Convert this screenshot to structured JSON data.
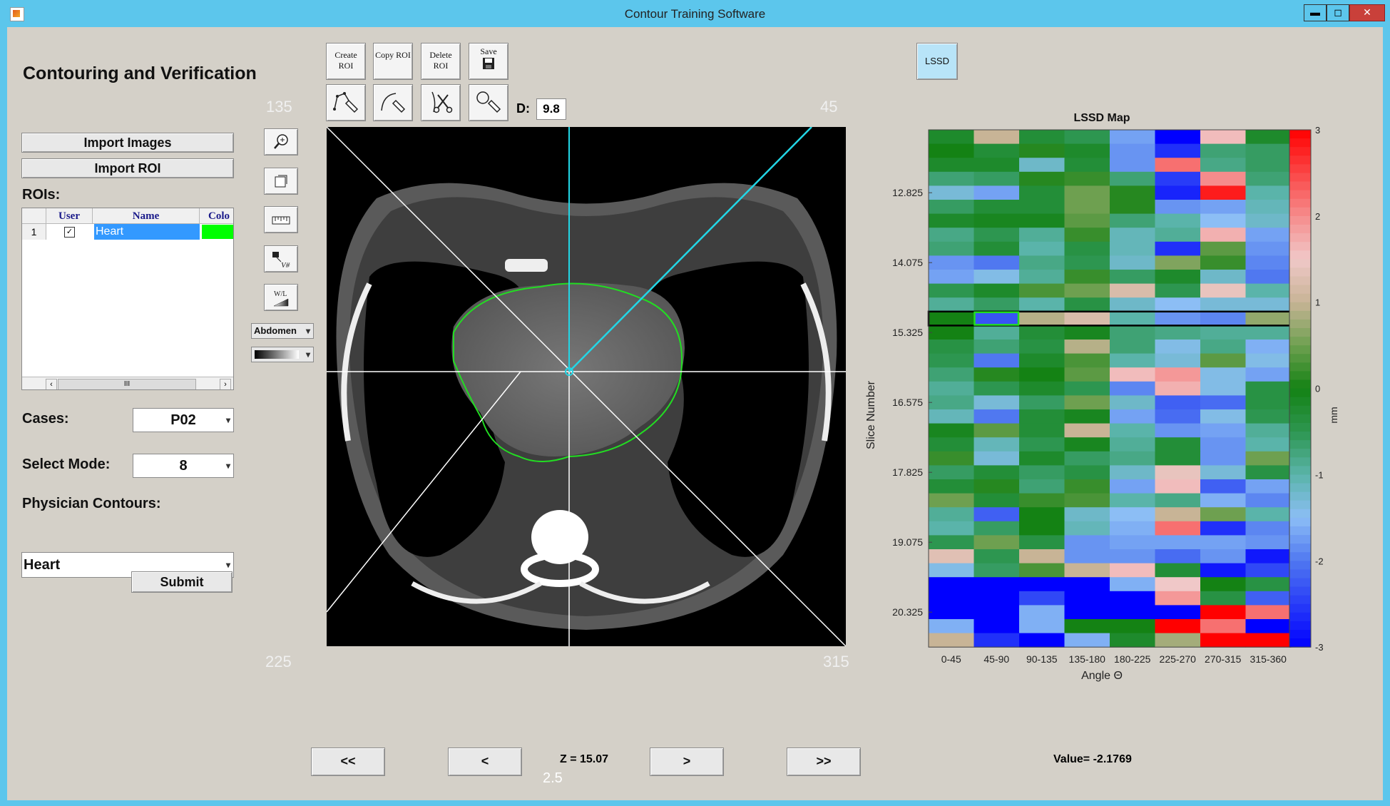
{
  "window": {
    "title": "Contour Training Software",
    "minimize": "▬",
    "maximize": "◻",
    "close": "✕"
  },
  "panel": {
    "heading": "Contouring and Verification",
    "import_images": "Import Images",
    "import_roi": "Import ROI",
    "rois_label": "ROIs:",
    "table": {
      "columns": [
        "User",
        "Name",
        "Colo"
      ],
      "rows": [
        {
          "index": "1",
          "user_checked": true,
          "name": "Heart",
          "color": "#00ff00"
        }
      ],
      "scroll_mid": "III"
    },
    "cases_label": "Cases:",
    "cases_value": "P02",
    "mode_label": "Select Mode:",
    "mode_value": "8",
    "physician_label": "Physician Contours:",
    "physician_value": "Heart",
    "submit": "Submit"
  },
  "toolbar": {
    "create_roi": "Create ROI",
    "copy_roi": "Copy ROI",
    "delete_roi": "Delete ROI",
    "save": "Save",
    "d_label": "D:",
    "d_value": "9.8",
    "window_preset": "Abdomen",
    "wl_label": "W/L",
    "vnum_label": "V#"
  },
  "viewer": {
    "angle_tl": "135",
    "angle_tr": "45",
    "angle_bl": "225",
    "angle_br": "315",
    "z_label": "Z = 15.07",
    "overlap_text": "2.5"
  },
  "nav": {
    "first": "<<",
    "prev": "<",
    "next": ">",
    "last": ">>"
  },
  "lssd": {
    "button": "LSSD",
    "value_label": "Value= -2.1769"
  },
  "chart_data": {
    "type": "heatmap",
    "title": "LSSD Map",
    "xlabel": "Angle Θ",
    "ylabel": "Slice Number",
    "x_categories": [
      "0-45",
      "45-90",
      "90-135",
      "135-180",
      "180-225",
      "225-270",
      "270-315",
      "315-360"
    ],
    "y_tick_labels": [
      "12.825",
      "14.075",
      "15.325",
      "16.575",
      "17.825",
      "19.075",
      "20.325"
    ],
    "y_tick_rows": [
      4.5,
      9.5,
      14.5,
      19.5,
      24.5,
      29.5,
      34.5
    ],
    "colorbar": {
      "min": -3,
      "max": 3,
      "ticks": [
        "3",
        "2",
        "1",
        "0",
        "-1",
        "-2",
        "-3"
      ],
      "unit": "mm"
    },
    "highlighted_row": 13,
    "highlighted_cell": [
      13,
      1
    ],
    "values": [
      [
        -0.2,
        1.0,
        -0.3,
        -0.5,
        -1.7,
        -3.0,
        1.6,
        -0.2
      ],
      [
        0.0,
        -0.3,
        0.1,
        -0.2,
        -1.8,
        -2.6,
        -0.7,
        -0.6
      ],
      [
        -0.2,
        -0.2,
        -1.2,
        -0.3,
        -1.8,
        2.2,
        -0.8,
        -0.6
      ],
      [
        -0.7,
        -0.6,
        0.1,
        0.2,
        -0.7,
        -2.5,
        2.0,
        -0.7
      ],
      [
        -1.3,
        -1.7,
        -0.3,
        0.5,
        0.1,
        -2.7,
        2.8,
        -1.0
      ],
      [
        -0.6,
        -0.3,
        -0.3,
        0.5,
        0.1,
        -1.8,
        -1.7,
        -1.1
      ],
      [
        -0.2,
        -0.1,
        -0.1,
        0.4,
        -0.7,
        -1.0,
        -1.5,
        -1.2
      ],
      [
        -0.8,
        -0.5,
        -0.9,
        0.2,
        -1.1,
        -0.9,
        1.7,
        -1.7
      ],
      [
        -0.7,
        -0.3,
        -1.0,
        -0.4,
        -1.1,
        -2.6,
        0.4,
        -1.8
      ],
      [
        -1.8,
        -2.0,
        -0.8,
        -0.5,
        -1.2,
        0.6,
        0.2,
        -1.9
      ],
      [
        -1.7,
        -1.4,
        -0.9,
        0.2,
        -0.6,
        -0.2,
        -1.2,
        -2.0
      ],
      [
        -0.5,
        -0.2,
        0.3,
        0.5,
        1.2,
        -0.5,
        1.4,
        -1.0
      ],
      [
        -0.9,
        -0.6,
        -1.0,
        -0.4,
        -1.2,
        -1.5,
        -1.3,
        -1.3
      ],
      [
        0.0,
        -2.3,
        0.9,
        1.2,
        -1.0,
        -1.8,
        -1.9,
        0.7
      ],
      [
        0.0,
        -0.9,
        -0.3,
        -0.1,
        -0.7,
        -0.8,
        -0.9,
        -0.9
      ],
      [
        -0.4,
        -0.7,
        -0.4,
        0.9,
        -0.7,
        -1.4,
        -0.8,
        -1.6
      ],
      [
        -0.5,
        -2.0,
        -0.2,
        0.3,
        -1.0,
        -1.3,
        0.4,
        -1.4
      ],
      [
        -0.7,
        0.1,
        0.0,
        0.4,
        1.6,
        1.9,
        -1.4,
        -1.7
      ],
      [
        -0.9,
        -0.5,
        -0.2,
        -0.5,
        -1.9,
        1.7,
        -1.4,
        -0.4
      ],
      [
        -0.8,
        -1.3,
        -0.6,
        0.5,
        -1.2,
        -2.2,
        -2.1,
        -0.4
      ],
      [
        -1.1,
        -2.0,
        -0.3,
        -0.1,
        -1.7,
        -2.1,
        -1.4,
        -0.5
      ],
      [
        -0.1,
        0.4,
        -0.3,
        1.0,
        -1.0,
        -1.8,
        -1.7,
        -0.9
      ],
      [
        -0.3,
        -1.1,
        -0.5,
        -0.1,
        -0.9,
        -0.3,
        -1.8,
        -1.0
      ],
      [
        0.2,
        -1.3,
        -0.2,
        -0.6,
        -0.8,
        -0.3,
        -1.8,
        0.5
      ],
      [
        -0.6,
        -0.3,
        -0.6,
        -0.4,
        -1.2,
        1.4,
        -1.3,
        -0.4
      ],
      [
        -0.3,
        0.1,
        -0.7,
        0.2,
        -1.7,
        1.6,
        -2.2,
        -1.7
      ],
      [
        0.5,
        -0.3,
        0.2,
        0.3,
        -1.0,
        -0.8,
        -1.6,
        -1.9
      ],
      [
        -0.9,
        -2.2,
        0.0,
        -1.2,
        -1.5,
        1.0,
        0.5,
        -1.0
      ],
      [
        -1.0,
        -0.6,
        0.0,
        -1.1,
        -1.6,
        2.2,
        -2.6,
        -1.9
      ],
      [
        -0.5,
        0.5,
        -0.4,
        -1.8,
        -1.7,
        -1.7,
        -1.7,
        -1.8
      ],
      [
        1.3,
        -0.5,
        1.0,
        -1.8,
        -1.8,
        -2.1,
        -1.8,
        -2.8
      ],
      [
        -1.4,
        -0.6,
        0.3,
        1.0,
        1.6,
        -0.3,
        -2.8,
        -2.4
      ],
      [
        -3.0,
        -3.0,
        -3.0,
        -3.0,
        -1.6,
        1.5,
        0.0,
        -0.4
      ],
      [
        -3.0,
        -3.0,
        -2.4,
        -3.0,
        -3.0,
        1.9,
        -0.4,
        -2.2
      ],
      [
        -3.0,
        -3.0,
        -1.6,
        -3.0,
        -3.0,
        -3.0,
        3.0,
        2.2
      ],
      [
        -1.6,
        -3.0,
        -1.6,
        0.0,
        0.0,
        3.0,
        2.2,
        -3.0
      ],
      [
        1.0,
        -2.6,
        -3.0,
        -1.6,
        -0.2,
        0.8,
        3.0,
        3.0
      ]
    ]
  }
}
